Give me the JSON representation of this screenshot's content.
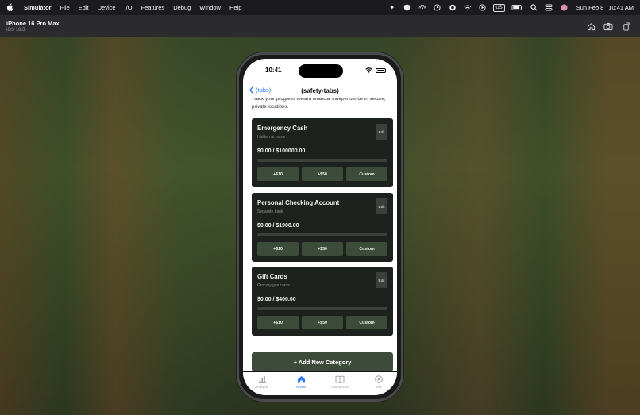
{
  "menubar": {
    "apple_icon": "apple-icon",
    "items": [
      "Simulator",
      "File",
      "Edit",
      "Device",
      "I/O",
      "Features",
      "Debug",
      "Window",
      "Help"
    ],
    "input_badge": "US",
    "date": "Sun Feb 8",
    "time": "10:41 AM"
  },
  "simulator": {
    "device_name": "iPhone 16 Pro Max",
    "os_version": "iOS 18.3"
  },
  "phone": {
    "status_time": "10:41",
    "status_dots": "....",
    "nav": {
      "back_label": "(tabs)",
      "title": "(safety-tabs)"
    },
    "intro_text": "Track your progress toward financial independence in secure, private locations.",
    "cards": [
      {
        "title": "Emergency Cash",
        "subtitle": "Hidden at home",
        "edit_label": "Edit",
        "amount": "$0.00 / $100000.00",
        "progress": 0,
        "buttons": [
          "+$10",
          "+$50",
          "Custom"
        ]
      },
      {
        "title": "Personal Checking Account",
        "subtitle": "Separate bank",
        "edit_label": "Edit",
        "amount": "$0.00 / $1900.00",
        "progress": 0,
        "buttons": [
          "+$10",
          "+$50",
          "Custom"
        ]
      },
      {
        "title": "Gift Cards",
        "subtitle": "Grocery/gas cards",
        "edit_label": "Edit",
        "amount": "$0.00 / $400.00",
        "progress": 0,
        "buttons": [
          "+$10",
          "+$50",
          "Custom"
        ]
      }
    ],
    "add_button_label": "+ Add New Category",
    "tabs": [
      {
        "label": "Analyzer",
        "icon": "chart-icon",
        "active": false
      },
      {
        "label": "Home",
        "icon": "house-icon",
        "active": true
      },
      {
        "label": "Resources",
        "icon": "book-icon",
        "active": false
      },
      {
        "label": "Exit",
        "icon": "close-circle-icon",
        "active": false
      }
    ]
  },
  "colors": {
    "accent": "#2f7df6",
    "card_bg": "#1e221e",
    "button_green": "#3d4b3a"
  }
}
